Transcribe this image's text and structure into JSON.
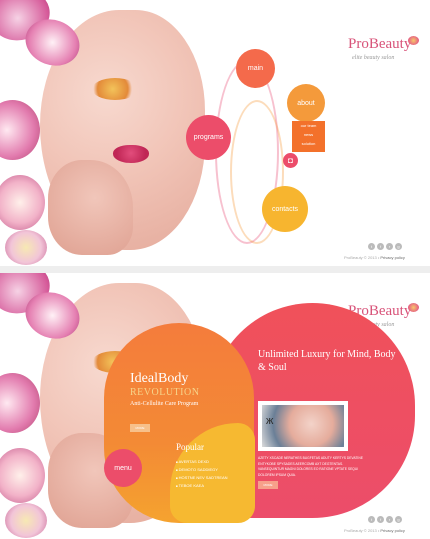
{
  "brand": {
    "name": "ProBeauty",
    "tagline": "elite beauty salon"
  },
  "top": {
    "nav": {
      "main": "main",
      "about": "about",
      "programs": "programs",
      "contacts": "contacts"
    },
    "submenu": [
      "our team",
      "news",
      "solution"
    ],
    "footer": {
      "copyright": "ProBeauty © 2013",
      "privacy": "Privacy policy"
    }
  },
  "bottom": {
    "menu_label": "menu",
    "idealbody": {
      "title": "IdealBody",
      "revolution": "REVOLUTION",
      "subtitle": "Anti-Cellulite Care Program",
      "more": "MORE"
    },
    "popular": {
      "title": "Popular",
      "items": [
        "AVERTAS DEXD",
        "DEMOTO SADDIEGY",
        "HOSTNE NEV SADTREAN",
        "TEBOE KAEA"
      ]
    },
    "luxury": {
      "title": "Unlimited Luxury for Mind, Body & Soul",
      "body": "AZETY XSCADE NERATHES BUGFETAS ADUTY KERTYS DEVATINE ENTYKOBE SPYSADES AEERCOMB AXT DEGTENTAS. VANSEQUINTUR MAGNI DOLORES EO RATIONE VPTATE SEQUI DOLOREM IPSUM QUIA.",
      "more": "MORE"
    },
    "footer": {
      "copyright": "ProBeauty © 2013",
      "privacy": "Privacy policy"
    }
  },
  "social": [
    "twitter-icon",
    "facebook-icon",
    "rss-icon",
    "google-icon"
  ],
  "colors": {
    "coral": "#f46a4b",
    "orange": "#f49a3b",
    "pink": "#ec4d6a",
    "yellow": "#f7b52f",
    "logo": "#d85379"
  }
}
